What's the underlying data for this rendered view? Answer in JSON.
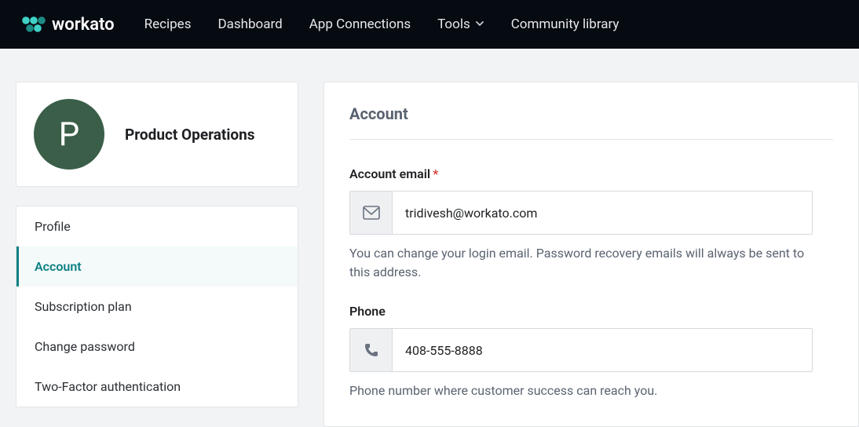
{
  "brand": {
    "name": "workato"
  },
  "nav": {
    "items": [
      {
        "label": "Recipes"
      },
      {
        "label": "Dashboard"
      },
      {
        "label": "App Connections"
      },
      {
        "label": "Tools",
        "dropdown": true
      },
      {
        "label": "Community library"
      }
    ]
  },
  "profile": {
    "initial": "P",
    "name": "Product Operations"
  },
  "sidebar": {
    "items": [
      {
        "label": "Profile",
        "active": false
      },
      {
        "label": "Account",
        "active": true
      },
      {
        "label": "Subscription plan",
        "active": false
      },
      {
        "label": "Change password",
        "active": false
      },
      {
        "label": "Two-Factor authentication",
        "active": false
      }
    ]
  },
  "section": {
    "title": "Account"
  },
  "form": {
    "email": {
      "label": "Account email",
      "required_mark": "*",
      "value": "tridivesh@workato.com",
      "help": "You can change your login email. Password recovery emails will always be sent to this address."
    },
    "phone": {
      "label": "Phone",
      "value": "408-555-8888",
      "help": "Phone number where customer success can reach you."
    }
  }
}
